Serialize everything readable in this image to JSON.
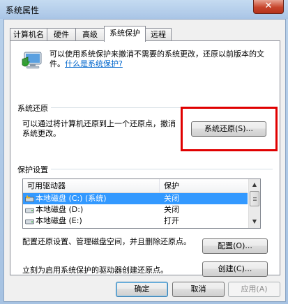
{
  "window": {
    "title": "系统属性",
    "close_label": "✕"
  },
  "tabs": [
    {
      "label": "计算机名"
    },
    {
      "label": "硬件"
    },
    {
      "label": "高级"
    },
    {
      "label": "系统保护",
      "active": true
    },
    {
      "label": "远程"
    }
  ],
  "intro": {
    "text": "可以使用系统保护来撤消不需要的系统更改，还原以前版本的文件。",
    "link": "什么是系统保护?"
  },
  "restore": {
    "group_title": "系统还原",
    "description": "可以通过将计算机还原到上一个还原点，撤消系统更改。",
    "button_label": "系统还原(S)..."
  },
  "protection": {
    "group_title": "保护设置",
    "columns": [
      "可用驱动器",
      "保护"
    ],
    "drives": [
      {
        "name": "本地磁盘 (C:) (系统)",
        "status": "关闭",
        "selected": true,
        "icon": "system-drive-icon"
      },
      {
        "name": "本地磁盘 (D:)",
        "status": "关闭",
        "selected": false,
        "icon": "hard-drive-icon"
      },
      {
        "name": "本地磁盘 (E:)",
        "status": "打开",
        "selected": false,
        "icon": "hard-drive-icon"
      }
    ]
  },
  "configure": {
    "text": "配置还原设置、管理磁盘空间，并且删除还原点。",
    "button_label": "配置(O)..."
  },
  "create": {
    "text": "立刻为启用系统保护的驱动器创建还原点。",
    "button_label": "创建(C)..."
  },
  "footer": {
    "ok": "确定",
    "cancel": "取消",
    "apply": "应用(A)"
  },
  "colors": {
    "highlight": "#e00000",
    "selection": "#3399ff",
    "link": "#0066cc"
  }
}
